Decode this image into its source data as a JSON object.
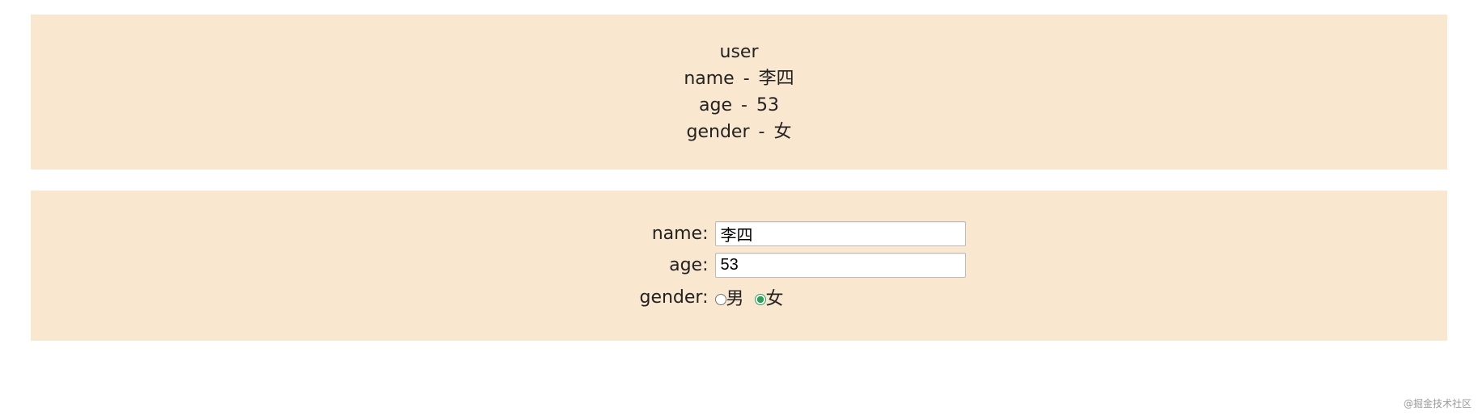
{
  "display": {
    "title": "user",
    "name_key": "name",
    "name_value": "李四",
    "age_key": "age",
    "age_value": "53",
    "gender_key": "gender",
    "gender_value": "女",
    "separator": " - "
  },
  "form": {
    "name_label": "name:",
    "name_value": "李四",
    "age_label": "age:",
    "age_value": "53",
    "gender_label": "gender:",
    "gender_options": {
      "male": "男",
      "female": "女"
    },
    "gender_selected": "female"
  },
  "watermark": "@掘金技术社区"
}
